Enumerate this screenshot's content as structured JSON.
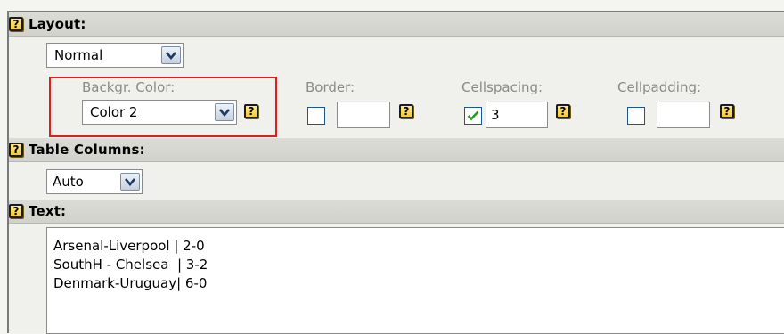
{
  "layout": {
    "header": "Layout:",
    "select_value": "Normal"
  },
  "options": {
    "background_color": {
      "label": "Backgr. Color:",
      "value": "Color 2"
    },
    "border": {
      "label": "Border:",
      "checked": false,
      "value": ""
    },
    "cellspacing": {
      "label": "Cellspacing:",
      "checked": true,
      "value": "3"
    },
    "cellpadding": {
      "label": "Cellpadding:",
      "checked": false,
      "value": ""
    }
  },
  "table_columns": {
    "header": "Table Columns:",
    "select_value": "Auto"
  },
  "text": {
    "header": "Text:",
    "lines": [
      "Arsenal-Liverpool | 2-0",
      "SouthH - Chelsea  | 3-2",
      "Denmark-Uruguay| 6-0"
    ]
  },
  "help_glyph": "?",
  "colors": {
    "highlight": "#e21b1b",
    "checkmark": "#2a9a20",
    "header_bg": "#d6d6d0"
  }
}
